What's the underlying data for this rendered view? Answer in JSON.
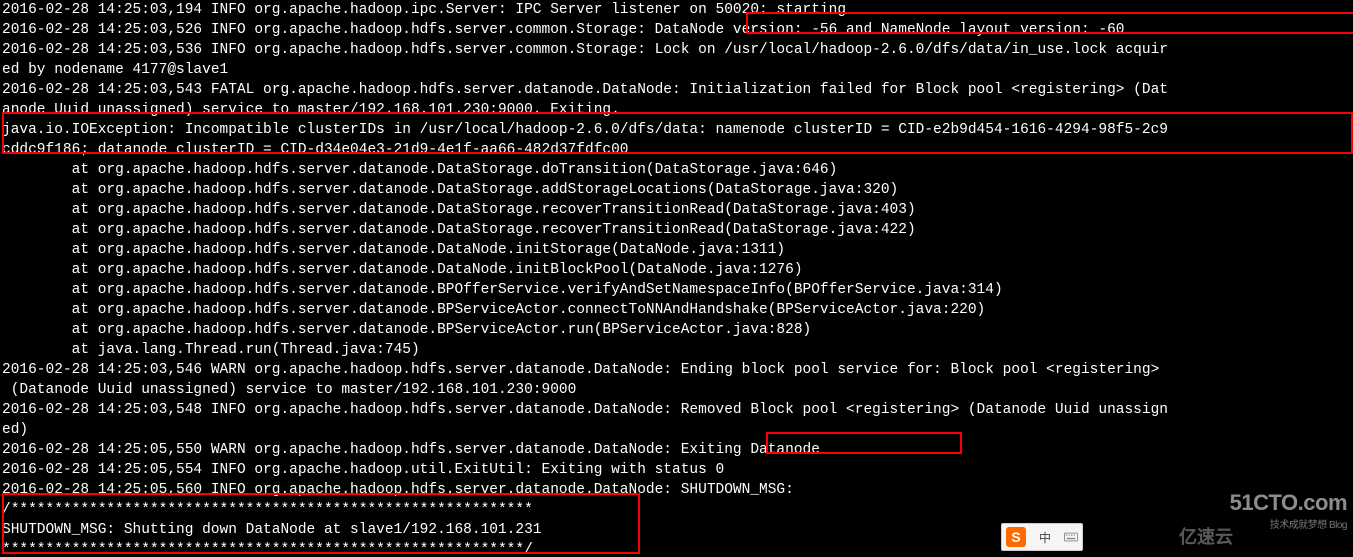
{
  "lines": [
    "2016-02-28 14:25:03,194 INFO org.apache.hadoop.ipc.Server: IPC Server listener on 50020: starting",
    "2016-02-28 14:25:03,526 INFO org.apache.hadoop.hdfs.server.common.Storage: DataNode version: -56 and NameNode layout version: -60",
    "2016-02-28 14:25:03,536 INFO org.apache.hadoop.hdfs.server.common.Storage: Lock on /usr/local/hadoop-2.6.0/dfs/data/in_use.lock acquir",
    "ed by nodename 4177@slave1",
    "2016-02-28 14:25:03,543 FATAL org.apache.hadoop.hdfs.server.datanode.DataNode: Initialization failed for Block pool <registering> (Dat",
    "anode Uuid unassigned) service to master/192.168.101.230:9000. Exiting.",
    "java.io.IOException: Incompatible clusterIDs in /usr/local/hadoop-2.6.0/dfs/data: namenode clusterID = CID-e2b9d454-1616-4294-98f5-2c9",
    "cddc9f186; datanode clusterID = CID-d34e04e3-21d9-4e1f-aa66-482d37fdfc00",
    "        at org.apache.hadoop.hdfs.server.datanode.DataStorage.doTransition(DataStorage.java:646)",
    "        at org.apache.hadoop.hdfs.server.datanode.DataStorage.addStorageLocations(DataStorage.java:320)",
    "        at org.apache.hadoop.hdfs.server.datanode.DataStorage.recoverTransitionRead(DataStorage.java:403)",
    "        at org.apache.hadoop.hdfs.server.datanode.DataStorage.recoverTransitionRead(DataStorage.java:422)",
    "        at org.apache.hadoop.hdfs.server.datanode.DataNode.initStorage(DataNode.java:1311)",
    "        at org.apache.hadoop.hdfs.server.datanode.DataNode.initBlockPool(DataNode.java:1276)",
    "        at org.apache.hadoop.hdfs.server.datanode.BPOfferService.verifyAndSetNamespaceInfo(BPOfferService.java:314)",
    "        at org.apache.hadoop.hdfs.server.datanode.BPServiceActor.connectToNNAndHandshake(BPServiceActor.java:220)",
    "        at org.apache.hadoop.hdfs.server.datanode.BPServiceActor.run(BPServiceActor.java:828)",
    "        at java.lang.Thread.run(Thread.java:745)",
    "2016-02-28 14:25:03,546 WARN org.apache.hadoop.hdfs.server.datanode.DataNode: Ending block pool service for: Block pool <registering>",
    " (Datanode Uuid unassigned) service to master/192.168.101.230:9000",
    "2016-02-28 14:25:03,548 INFO org.apache.hadoop.hdfs.server.datanode.DataNode: Removed Block pool <registering> (Datanode Uuid unassign",
    "ed)",
    "2016-02-28 14:25:05,550 WARN org.apache.hadoop.hdfs.server.datanode.DataNode: Exiting Datanode",
    "2016-02-28 14:25:05,554 INFO org.apache.hadoop.util.ExitUtil: Exiting with status 0",
    "2016-02-28 14:25:05,560 INFO org.apache.hadoop.hdfs.server.datanode.DataNode: SHUTDOWN_MSG:",
    "/************************************************************",
    "SHUTDOWN_MSG: Shutting down DataNode at slave1/192.168.101.231",
    "************************************************************/"
  ],
  "watermarks": {
    "cto": "51CTO.com",
    "cto_sub": "技术成就梦想  Blog",
    "yisu": "亿速云"
  },
  "sogou": {
    "letter": "S",
    "label": "中"
  }
}
